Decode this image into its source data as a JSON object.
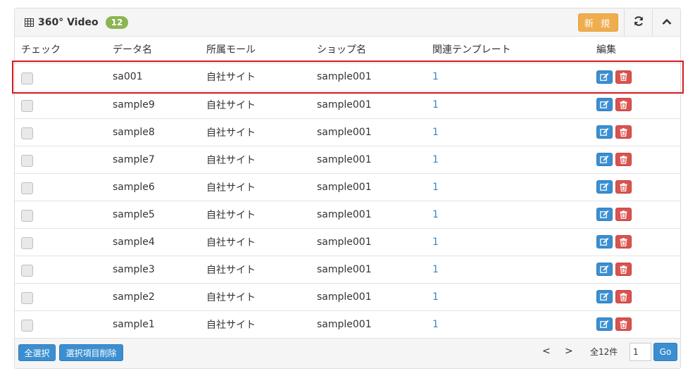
{
  "panel": {
    "title": "360° Video",
    "count": "12",
    "new_label": "新 規"
  },
  "table": {
    "headers": [
      "チェック",
      "データ名",
      "所属モール",
      "ショップ名",
      "関連テンプレート",
      "編集"
    ],
    "rows": [
      {
        "name": "sa001",
        "mall": "自社サイト",
        "shop": "sample001",
        "templates": "1"
      },
      {
        "name": "sample9",
        "mall": "自社サイト",
        "shop": "sample001",
        "templates": "1"
      },
      {
        "name": "sample8",
        "mall": "自社サイト",
        "shop": "sample001",
        "templates": "1"
      },
      {
        "name": "sample7",
        "mall": "自社サイト",
        "shop": "sample001",
        "templates": "1"
      },
      {
        "name": "sample6",
        "mall": "自社サイト",
        "shop": "sample001",
        "templates": "1"
      },
      {
        "name": "sample5",
        "mall": "自社サイト",
        "shop": "sample001",
        "templates": "1"
      },
      {
        "name": "sample4",
        "mall": "自社サイト",
        "shop": "sample001",
        "templates": "1"
      },
      {
        "name": "sample3",
        "mall": "自社サイト",
        "shop": "sample001",
        "templates": "1"
      },
      {
        "name": "sample2",
        "mall": "自社サイト",
        "shop": "sample001",
        "templates": "1"
      },
      {
        "name": "sample1",
        "mall": "自社サイト",
        "shop": "sample001",
        "templates": "1"
      }
    ]
  },
  "footer": {
    "select_all_label": "全選択",
    "delete_selected_label": "選択項目削除",
    "prev_label": "<",
    "next_label": ">",
    "total_label": "全12件",
    "page_value": "1",
    "go_label": "Go"
  },
  "icons": {
    "title": "table-grid-icon",
    "refresh": "refresh-icon",
    "collapse": "chevron-up-icon",
    "edit": "edit-icon",
    "delete": "trash-icon"
  },
  "colors": {
    "badge": "#8bb552",
    "new_button": "#f0ad4e",
    "primary": "#3b8fd0",
    "danger": "#d9534f",
    "highlight": "#d9181f",
    "link": "#3a87c8"
  }
}
